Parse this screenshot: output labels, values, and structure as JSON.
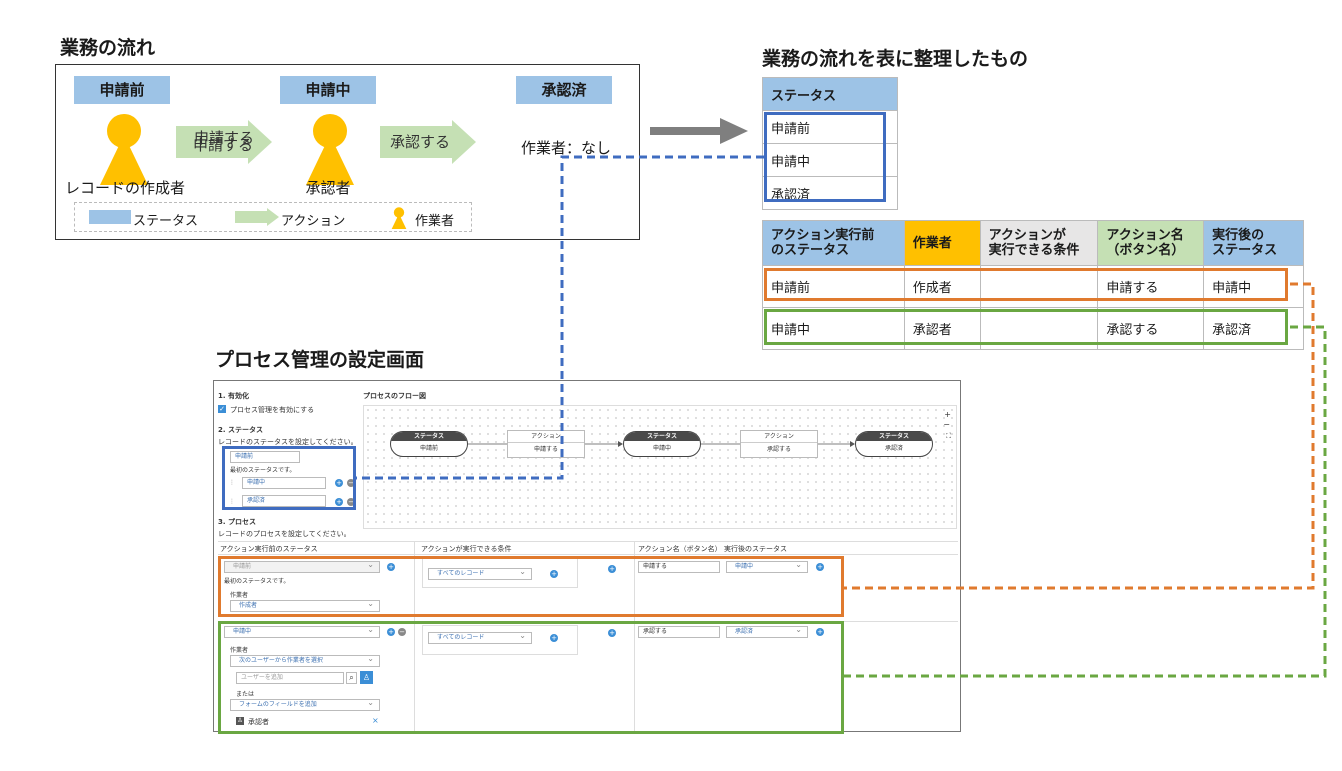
{
  "flow": {
    "title": "業務の流れ",
    "statuses": [
      "申請前",
      "申請中",
      "承認済"
    ],
    "actions": [
      "申請する",
      "承認する"
    ],
    "workers": [
      "レコードの作成者",
      "承認者"
    ],
    "final_note": "作業者：なし",
    "legend": {
      "status": "ステータス",
      "action": "アクション",
      "worker": "作業者"
    }
  },
  "table": {
    "title": "業務の流れを表に整理したもの",
    "status_header": "ステータス",
    "status_rows": [
      "申請前",
      "申請中",
      "承認済"
    ],
    "action_headers": [
      "アクション実行前\nのステータス",
      "作業者",
      "アクションが\n実行できる条件",
      "アクション名\n（ボタン名）",
      "実行後の\nステータス"
    ],
    "header_colors": [
      "#9dc3e6",
      "#ffc000",
      "#e7e6e6",
      "#c5e0b4",
      "#9dc3e6"
    ],
    "action_rows": [
      [
        "申請前",
        "作成者",
        "",
        "申請する",
        "申請中"
      ],
      [
        "申請中",
        "承認者",
        "",
        "承認する",
        "承認済"
      ]
    ]
  },
  "settings": {
    "title": "プロセス管理の設定画面",
    "section1": "1. 有効化",
    "enable_label": "プロセス管理を有効にする",
    "section2": "2. ステータス",
    "status_hint": "レコードのステータスを設定してください。",
    "status_values": [
      "申請前",
      "申請中",
      "承認済"
    ],
    "initial_status_note": "最初のステータスです。",
    "flow_title": "プロセスのフロー図",
    "node_status_label": "ステータス",
    "node_action_label": "アクション",
    "flow_nodes": [
      "申請前",
      "申請する",
      "申請中",
      "承認する",
      "承認済"
    ],
    "section3": "3. プロセス",
    "process_hint": "レコードのプロセスを設定してください。",
    "col_headers": [
      "アクション実行前のステータス",
      "アクションが実行できる条件",
      "アクション名（ボタン名）",
      "実行後のステータス"
    ],
    "row1": {
      "status": "申請前",
      "note": "最初のステータスです。",
      "worker_label": "作業者",
      "worker": "作成者",
      "condition": "すべてのレコード",
      "action": "申請する",
      "next": "申請中"
    },
    "row2": {
      "status": "申請中",
      "worker_label": "作業者",
      "worker_select": "次のユーザーから作業者を選択",
      "user_placeholder": "ユーザーを追加",
      "or_label": "または",
      "field_select": "フォームのフィールドを追加",
      "approver": "承認者",
      "condition": "すべてのレコード",
      "action": "承認する",
      "next": "承認済"
    },
    "zoom": [
      "+",
      "−",
      "⛶"
    ]
  },
  "colors": {
    "blue": "#3f6cc0",
    "orange": "#e07a2e",
    "green": "#6aa742",
    "status_fill": "#9dc3e6",
    "arrow_fill": "#c5e0b4",
    "person": "#ffc000"
  }
}
